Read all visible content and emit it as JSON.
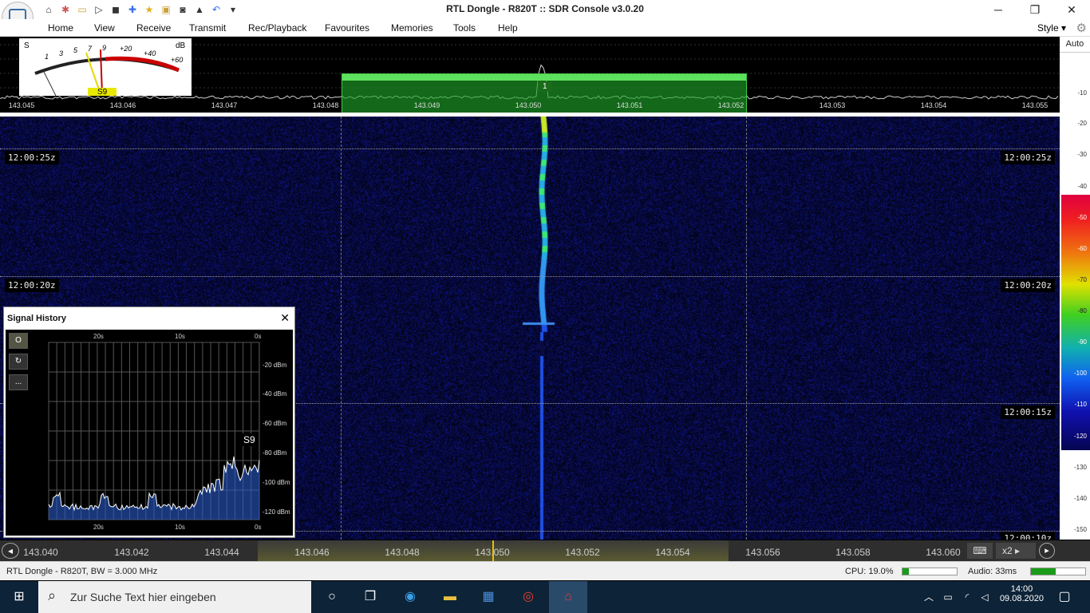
{
  "app": {
    "title": "RTL Dongle - R820T :: SDR Console v3.0.20",
    "qat_icons": [
      "home-icon",
      "settings-icon",
      "folder-icon",
      "play-icon",
      "stop-icon",
      "add-icon",
      "star-icon",
      "lock-icon",
      "camera-icon",
      "antenna-icon",
      "undo-icon",
      "more-icon"
    ]
  },
  "menu": {
    "items": [
      "Home",
      "View",
      "Receive",
      "Transmit",
      "Rec/Playback",
      "Favourites",
      "Memories",
      "Tools",
      "Help"
    ],
    "style_label": "Style"
  },
  "spectrum": {
    "auto_label": "Auto",
    "freq_ticks": [
      "143.045",
      "143.046",
      "143.047",
      "143.048",
      "143.049",
      "143.050",
      "143.051",
      "143.052",
      "143.053",
      "143.054",
      "143.055"
    ],
    "passband_label": "1",
    "db_scale": [
      "-10",
      "-20",
      "-30",
      "-40",
      "-50",
      "-60",
      "-70",
      "-80",
      "-90",
      "-100",
      "-110",
      "-120",
      "-130",
      "-140",
      "-150"
    ]
  },
  "smeter": {
    "s_label": "S",
    "db_label": "dB",
    "scale_s": [
      "1",
      "3",
      "5",
      "7",
      "9"
    ],
    "scale_db": [
      "+20",
      "+40",
      "+60"
    ],
    "reading": "S9"
  },
  "waterfall": {
    "timestamps": [
      "12:00:25z",
      "12:00:20z",
      "12:00:15z",
      "12:00:10z"
    ]
  },
  "signal_history": {
    "title": "Signal History",
    "top_ticks": [
      "20s",
      "10s",
      "0s"
    ],
    "bottom_ticks": [
      "20s",
      "10s",
      "0s"
    ],
    "db_ticks": [
      "-20 dBm",
      "-40 dBm",
      "-60 dBm",
      "-80 dBm",
      "-100 dBm",
      "-120 dBm"
    ],
    "s_reading": "S9",
    "buttons": [
      "O",
      "↻",
      "..."
    ]
  },
  "bottom_freqs": [
    "143.040",
    "143.042",
    "143.044",
    "143.046",
    "143.048",
    "143.050",
    "143.052",
    "143.054",
    "143.056",
    "143.058",
    "143.060"
  ],
  "bottom_controls": {
    "zoom": "x2"
  },
  "status": {
    "device": "RTL Dongle - R820T, BW = 3.000 MHz",
    "cpu": "CPU: 19.0%",
    "audio": "Audio: 33ms",
    "cpu_level": 0.12,
    "audio_level": 0.45
  },
  "taskbar": {
    "search_placeholder": "Zur Suche Text hier eingeben",
    "time": "14:00",
    "date": "09.08.2020"
  }
}
